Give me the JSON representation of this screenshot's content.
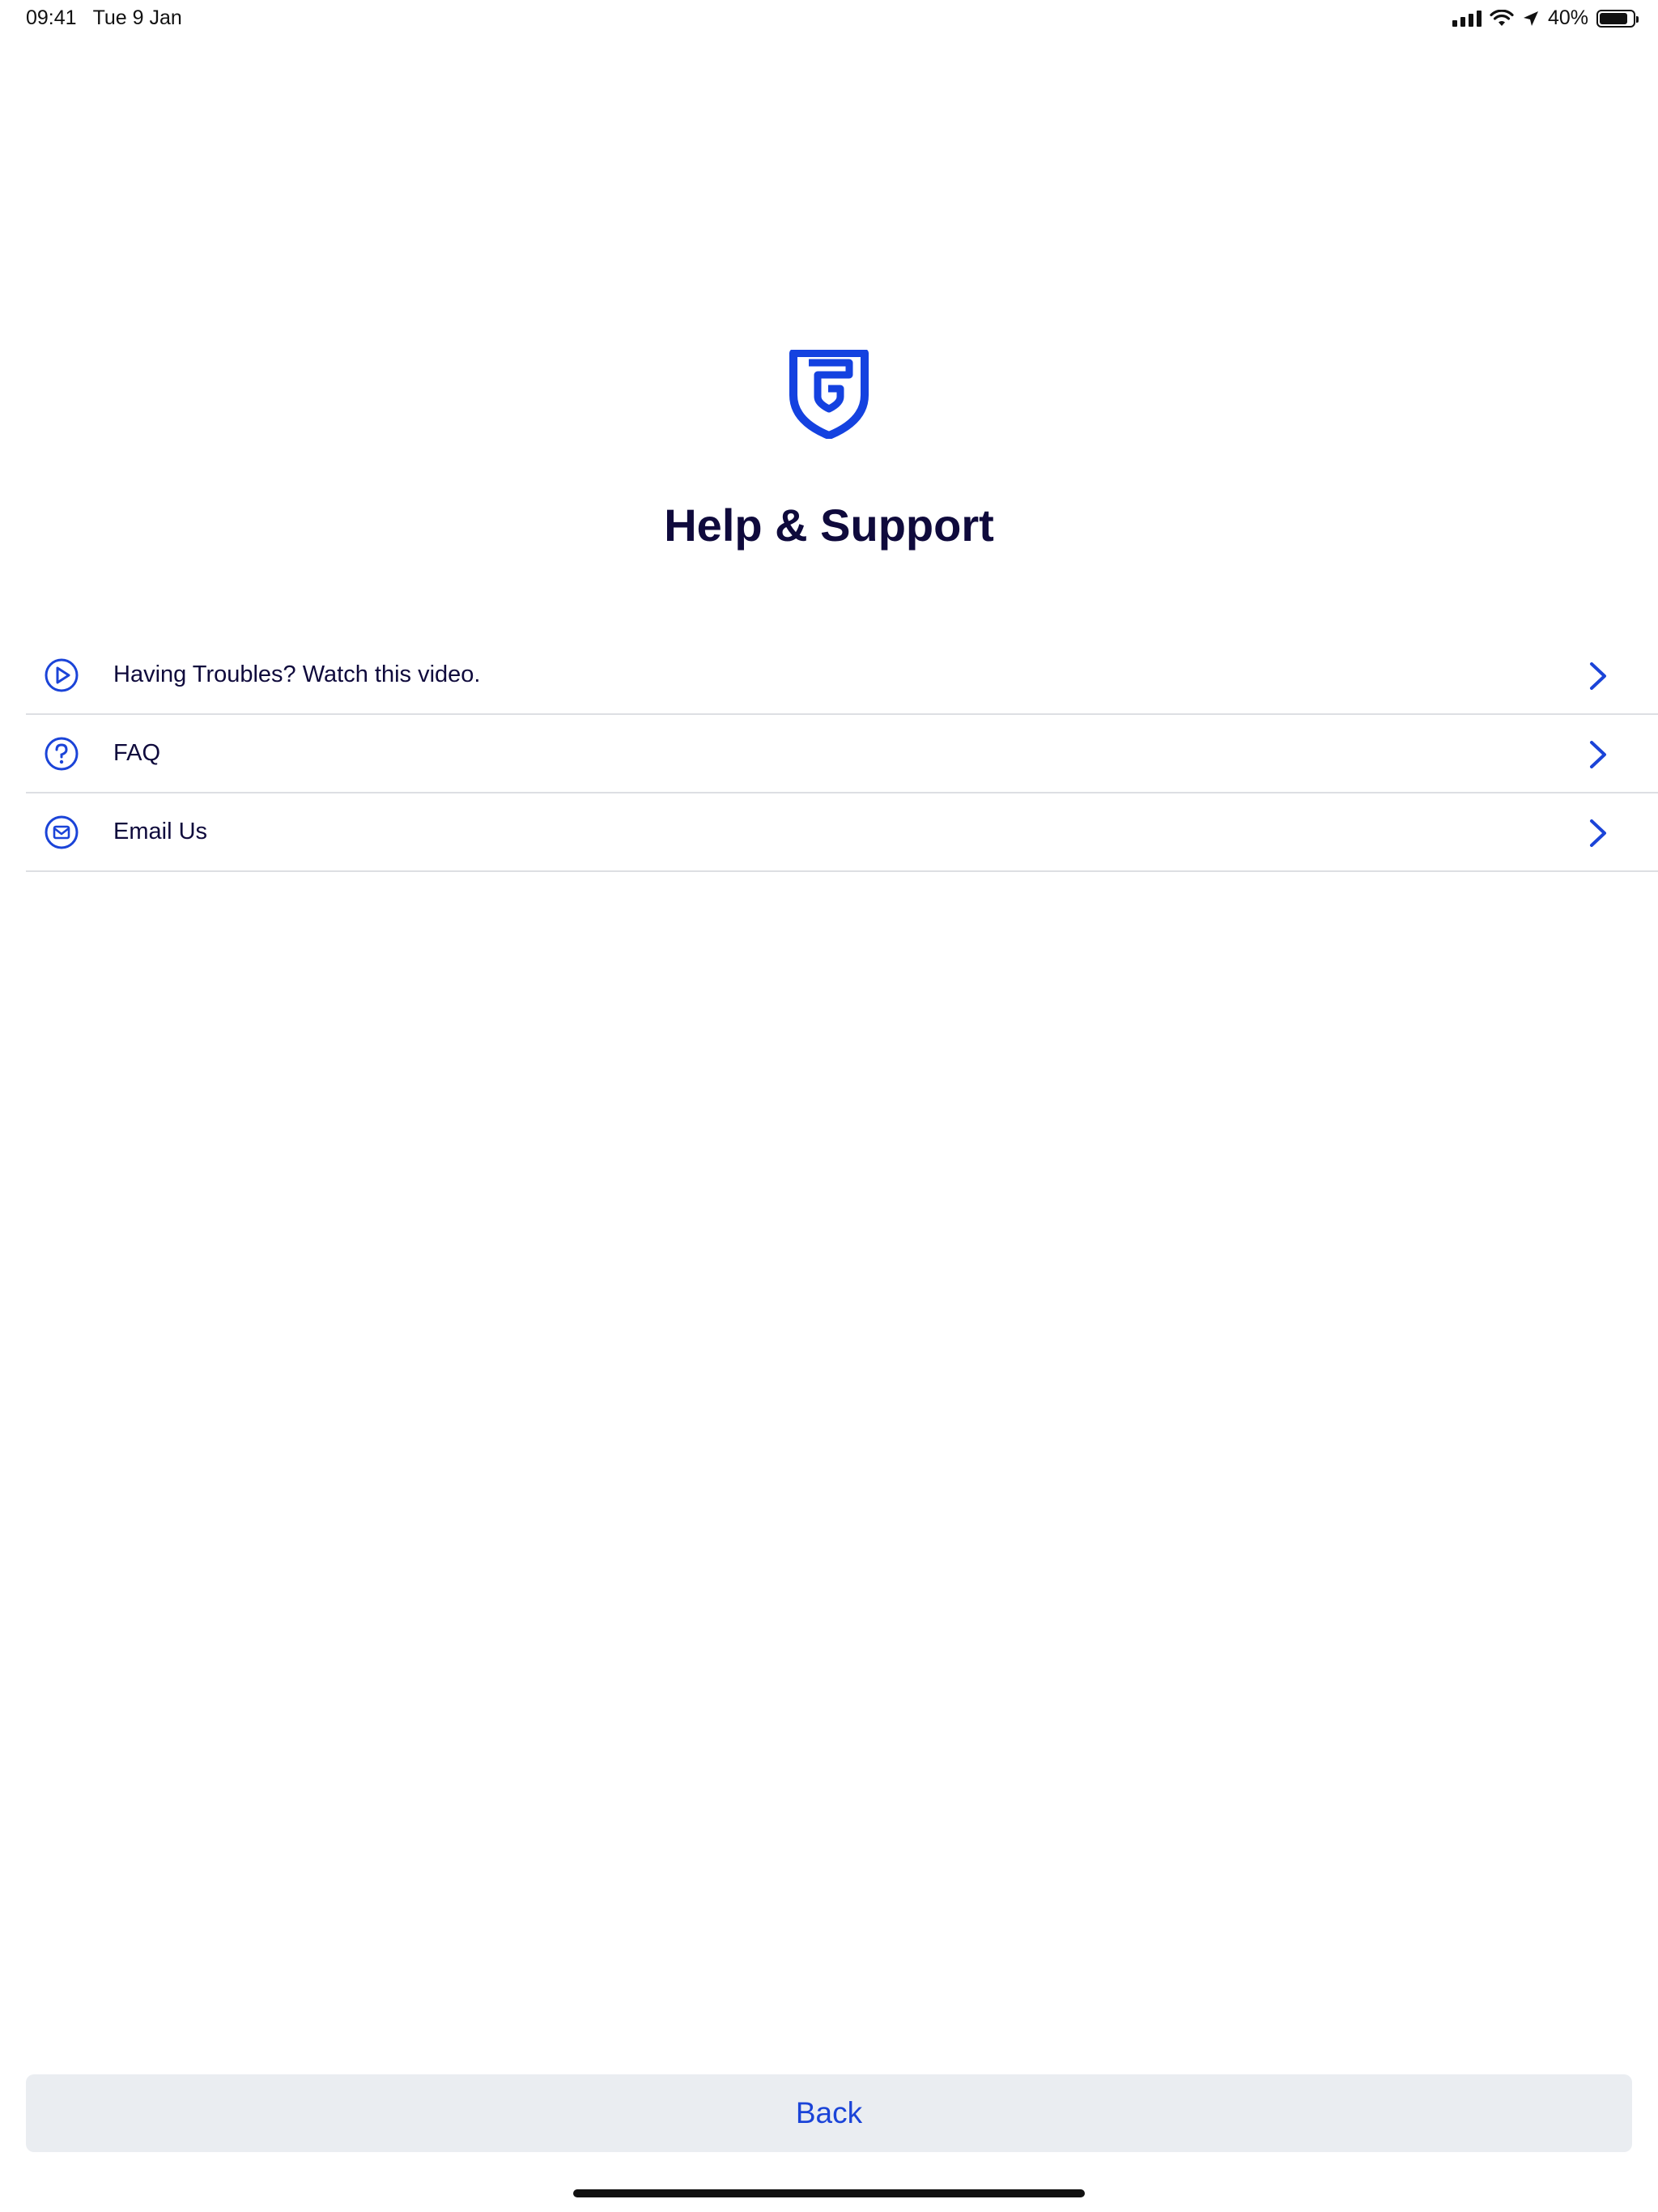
{
  "status_bar": {
    "time": "09:41",
    "date": "Tue 9 Jan",
    "battery_percent": "40%",
    "battery_level": 0.4
  },
  "logo": {
    "icon": "shield-logo-icon",
    "color": "#1442e0"
  },
  "page": {
    "title": "Help & Support"
  },
  "menu": {
    "items": [
      {
        "label": "Having Troubles? Watch this video.",
        "icon": "play-circle-icon"
      },
      {
        "label": "FAQ",
        "icon": "question-circle-icon"
      },
      {
        "label": "Email Us",
        "icon": "mail-circle-icon"
      }
    ]
  },
  "footer": {
    "back_label": "Back"
  },
  "colors": {
    "accent": "#1b44d8",
    "text": "#0f0a3c",
    "divider": "#dddfe3",
    "button_bg": "#eaedf1"
  }
}
